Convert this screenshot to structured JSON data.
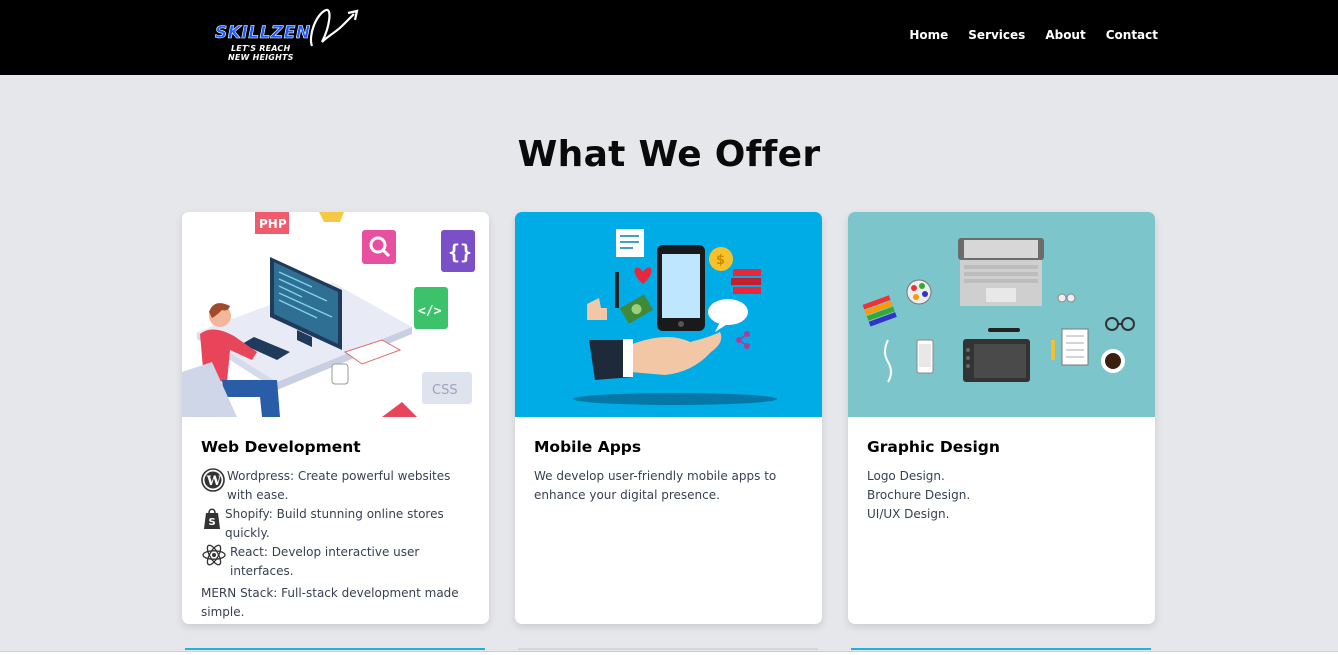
{
  "header": {
    "logo_name": "SKILLZEN",
    "logo_tagline_1": "LET'S REACH",
    "logo_tagline_2": "NEW HEIGHTS",
    "nav": [
      {
        "label": "Home"
      },
      {
        "label": "Services"
      },
      {
        "label": "About"
      },
      {
        "label": "Contact"
      }
    ]
  },
  "section": {
    "title": "What We Offer"
  },
  "cards": [
    {
      "title": "Web Development",
      "image": "web-development-illustration",
      "items": [
        {
          "icon": "wordpress-icon",
          "text": "Wordpress: Create powerful websites with ease."
        },
        {
          "icon": "shopify-icon",
          "text": "Shopify: Build stunning online stores quickly."
        },
        {
          "icon": "react-icon",
          "text": "React: Develop interactive user interfaces."
        },
        {
          "icon": "",
          "text": "MERN Stack: Full-stack development made simple."
        }
      ]
    },
    {
      "title": "Mobile Apps",
      "image": "mobile-apps-illustration",
      "bg": "#00ace6",
      "description": "We develop user-friendly mobile apps to enhance your digital presence."
    },
    {
      "title": "Graphic Design",
      "image": "graphic-design-illustration",
      "bg": "#7cc5cb",
      "lines": [
        "Logo Design.",
        "Brochure Design.",
        "UI/UX Design."
      ]
    }
  ],
  "colors": {
    "navbar": "#000000",
    "page_bg": "#e5e7eb",
    "logo_blue": "#1e5bff",
    "mobile_bg": "#00ace6",
    "graphic_bg": "#7cc5cb"
  }
}
